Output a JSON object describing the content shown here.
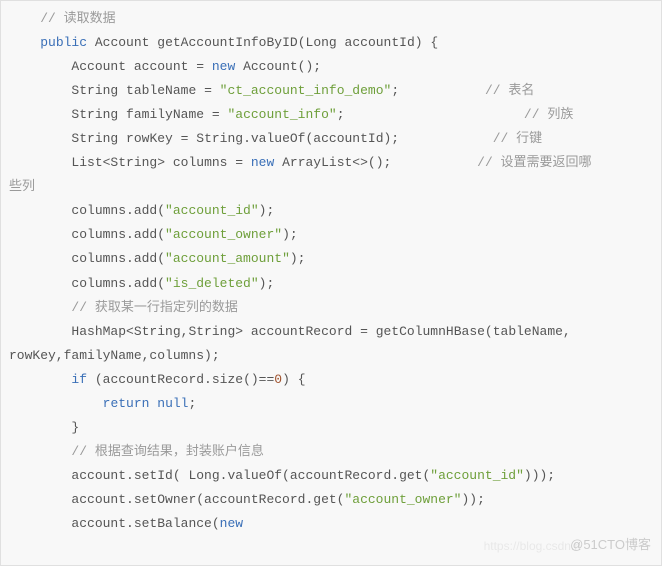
{
  "code": {
    "cmt_read_data": "// 读取数据",
    "kw_public": "public",
    "type_account": "Account",
    "method_name": "getAccountInfoByID",
    "param_type": "Long",
    "param_name": "accountId",
    "type_account2": "Account",
    "var_account": "account",
    "kw_new": "new",
    "ctor_account": "Account();",
    "type_string": "String",
    "var_tableName": "tableName",
    "str_tableName": "\"ct_account_info_demo\"",
    "cmt_tableName": "// 表名",
    "var_familyName": "familyName",
    "str_familyName": "\"account_info\"",
    "cmt_familyName": "// 列族",
    "var_rowKey": "rowKey",
    "expr_rowKey": "String.valueOf(accountId);",
    "cmt_rowKey": "// 行键",
    "type_list": "List<String>",
    "var_columns": "columns",
    "ctor_arraylist": "ArrayList<>();",
    "cmt_columns": "// 设置需要返回哪",
    "cmt_columns2": "些列",
    "col_add1": "columns.add(",
    "str_account_id": "\"account_id\"",
    "str_account_owner": "\"account_owner\"",
    "str_account_amount": "\"account_amount\"",
    "str_is_deleted": "\"is_deleted\"",
    "close_paren": ");",
    "cmt_getrow": "// 获取某一行指定列的数据",
    "type_hashmap": "HashMap<String,String>",
    "var_accountRecord": "accountRecord",
    "call_getColumnHBase": "getColumnHBase(tableName,",
    "args_continue": "rowKey,familyName,columns);",
    "kw_if": "if",
    "cond_size": "(accountRecord.size()==",
    "num_zero": "0",
    "cond_close": ") {",
    "kw_return": "return",
    "kw_null": "null",
    "semi": ";",
    "brace_close": "}",
    "cmt_assemble": "// 根据查询结果，封装账户信息",
    "stmt_setId_a": "account.setId( Long.valueOf(accountRecord.get(",
    "stmt_setId_b": ")));",
    "stmt_setOwner_a": "account.setOwner(accountRecord.get(",
    "stmt_setOwner_b": "));",
    "stmt_setBalance": "account.setBalance(",
    "sp4": "    ",
    "sp8": "        "
  },
  "watermark1": "@51CTO博客",
  "watermark2": "https://blog.csdn.n"
}
